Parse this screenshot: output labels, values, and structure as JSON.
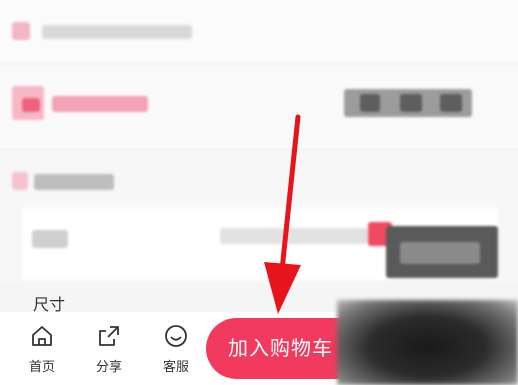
{
  "product_detail": {
    "size_section_title": "尺寸"
  },
  "bottom_nav": {
    "items": [
      {
        "label": "首页",
        "icon": "home-icon"
      },
      {
        "label": "分享",
        "icon": "share-icon"
      },
      {
        "label": "客服",
        "icon": "smiley-icon"
      }
    ],
    "add_to_cart_label": "加入购物车",
    "add_to_cart_color": "#f23a5e"
  },
  "annotation": {
    "arrow_color": "#e8141b"
  }
}
